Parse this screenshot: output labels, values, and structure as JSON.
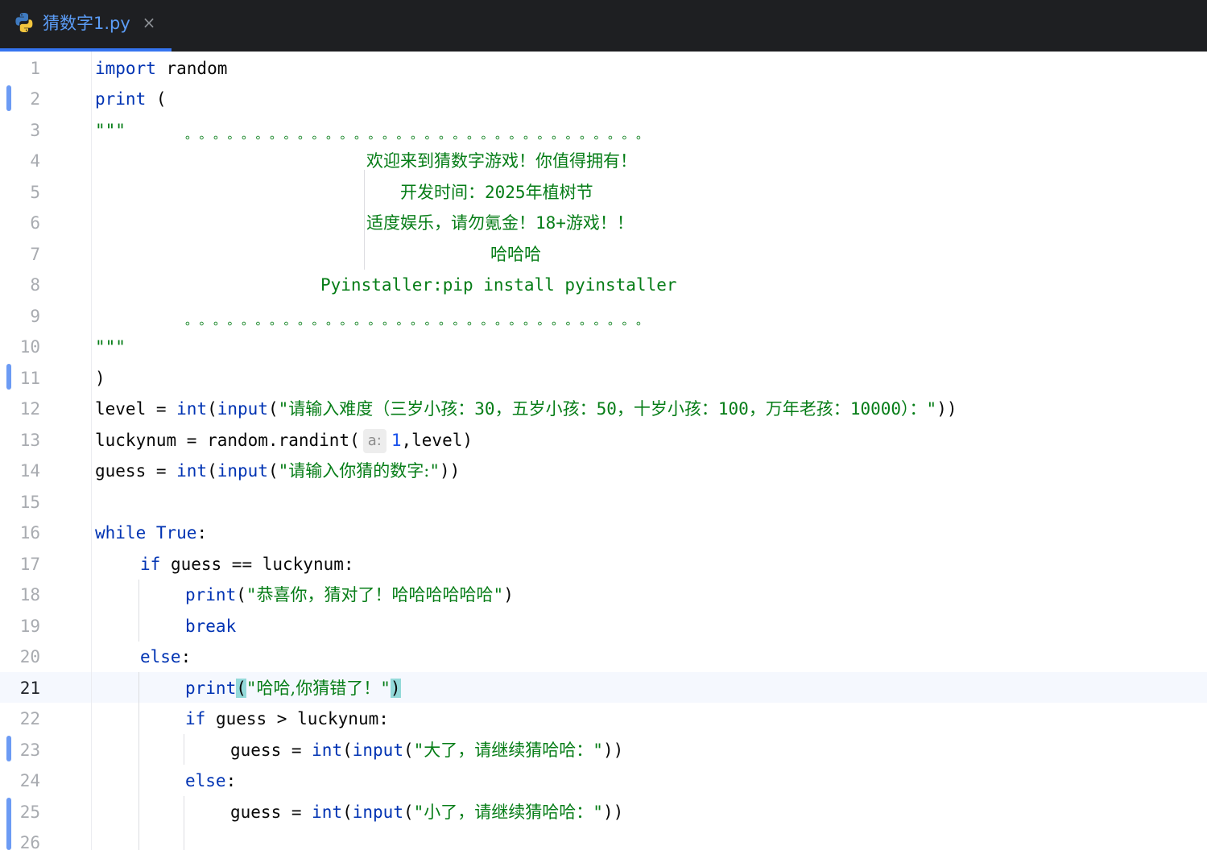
{
  "tab": {
    "icon": "python-file-icon",
    "title": "猜数字1.py",
    "close_glyph": "×"
  },
  "editor": {
    "current_line": 21,
    "line_numbers": [
      "1",
      "2",
      "3",
      "4",
      "5",
      "6",
      "7",
      "8",
      "9",
      "10",
      "11",
      "12",
      "13",
      "14",
      "15",
      "16",
      "17",
      "18",
      "19",
      "20",
      "21",
      "22",
      "23",
      "24",
      "25",
      "26"
    ],
    "lines": {
      "l1": {
        "kw": "import",
        "rest": " random"
      },
      "l2": {
        "fn": "print",
        "rest": " ("
      },
      "l3": {
        "quote": "\"\"\"",
        "dots": "。。。。。。。。。。。。。。。。。。。。。。。。。。。。。。。。。"
      },
      "l4": {
        "text": "欢迎来到猜数字游戏！你值得拥有！"
      },
      "l5": {
        "text_a": "开发时间：",
        "text_b": "2025",
        "text_c": "年植树节"
      },
      "l6": {
        "text_a": "适度娱乐，请勿氪金！",
        "text_b": "18+",
        "text_c": "游戏！！"
      },
      "l7": {
        "text": "哈哈哈"
      },
      "l8": {
        "text": "Pyinstaller:pip install pyinstaller"
      },
      "l9": {
        "dots": "。。。。。。。。。。。。。。。。。。。。。。。。。。。。。。。。。"
      },
      "l10": {
        "quote": "\"\"\""
      },
      "l11": {
        "rest": ")"
      },
      "l12": {
        "var": "level = ",
        "int": "int",
        "open": "(",
        "input": "input",
        "open2": "(",
        "q1": "\"",
        "s1": "请输入难度（三岁小孩：",
        "n1": "30",
        "s2": "，五岁小孩：",
        "n2": "50",
        "s3": "，十岁小孩：",
        "n3": "100",
        "s4": "，万年老孩：",
        "n4": "10000",
        "s5": "）：",
        "q2": "\"",
        "close": "))"
      },
      "l13": {
        "var": "luckynum = random.randint(",
        "hint": "a:",
        "num": "1",
        "rest": ",level)"
      },
      "l14": {
        "var": "guess = ",
        "int": "int",
        "open": "(",
        "input": "input",
        "open2": "(",
        "q1": "\"",
        "s1": "请输入你猜的数字:",
        "q2": "\"",
        "close": "))"
      },
      "l16": {
        "kw": "while",
        "sp": " ",
        "kw2": "True",
        "rest": ":"
      },
      "l17": {
        "kw": "if",
        "rest": " guess == luckynum:"
      },
      "l18": {
        "fn": "print",
        "open": "(",
        "q1": "\"",
        "s1": "恭喜你，猜对了！哈哈哈哈哈哈",
        "q2": "\"",
        "close": ")"
      },
      "l19": {
        "kw": "break"
      },
      "l20": {
        "kw": "else",
        "rest": ":"
      },
      "l21": {
        "fn": "print",
        "open": "(",
        "q1": "\"",
        "s1": "哈哈,你猜错了！",
        "q2": "\"",
        "close": ")"
      },
      "l22": {
        "kw": "if",
        "rest": " guess > luckynum:"
      },
      "l23": {
        "var": "guess = ",
        "int": "int",
        "open": "(",
        "input": "input",
        "open2": "(",
        "q1": "\"",
        "s1": "大了，请继续猜哈哈：",
        "q2": "\"",
        "close": "))"
      },
      "l24": {
        "kw": "else",
        "rest": ":"
      },
      "l25": {
        "var": "guess = ",
        "int": "int",
        "open": "(",
        "input": "input",
        "open2": "(",
        "q1": "\"",
        "s1": "小了，请继续猜哈哈：",
        "q2": "\"",
        "close": "))"
      }
    }
  },
  "colors": {
    "tabbar_bg": "#1e1f22",
    "tab_accent": "#3574f0",
    "keyword": "#0033b3",
    "string": "#067d17",
    "number": "#1750eb",
    "current_line_bg": "#f5f8fe",
    "change_marker": "#6c9bf4"
  }
}
